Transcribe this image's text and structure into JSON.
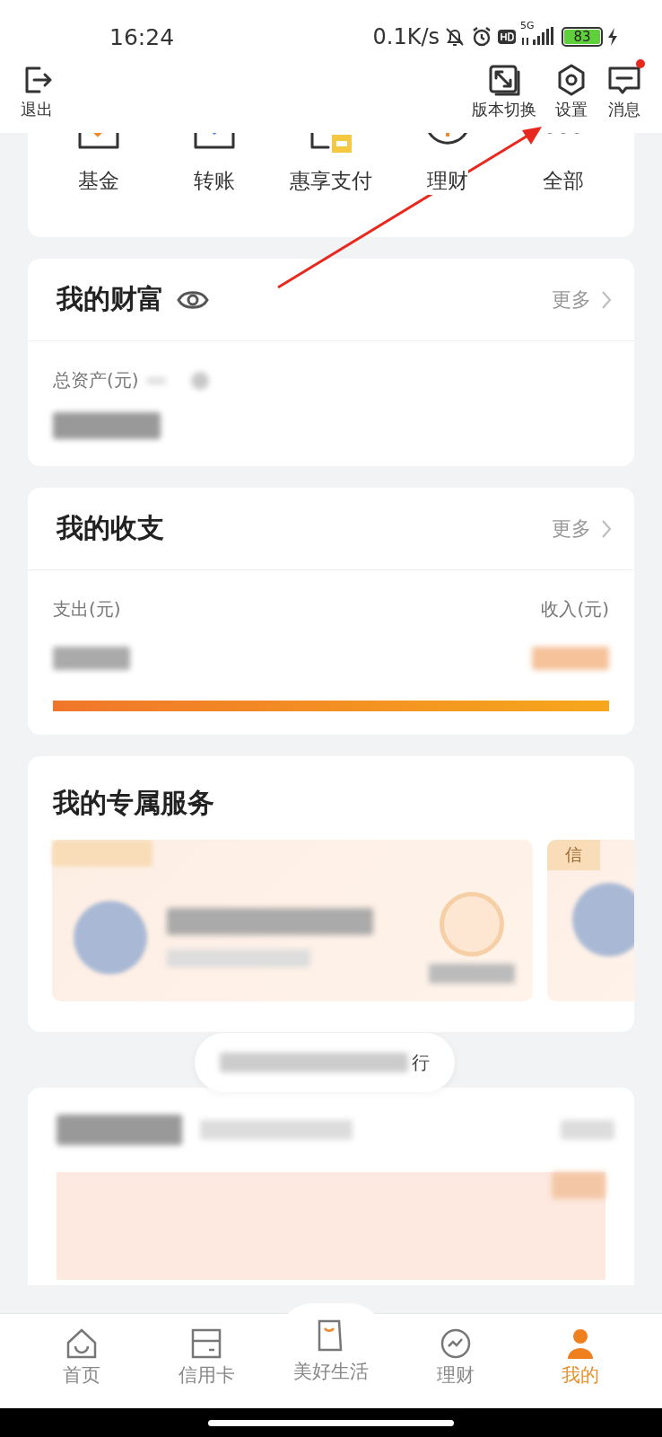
{
  "status_bar": {
    "time": "16:24",
    "speed": "0.1K/s",
    "network": "5G",
    "battery": "83"
  },
  "header": {
    "exit": "退出",
    "actions": [
      {
        "label": "版本切换",
        "kind": "switch",
        "unread": false
      },
      {
        "label": "设置",
        "kind": "settings",
        "unread": false
      },
      {
        "label": "消息",
        "kind": "message",
        "unread": true
      }
    ]
  },
  "shortcuts": [
    {
      "label": "基金",
      "kind": "fund"
    },
    {
      "label": "转账",
      "kind": "transfer"
    },
    {
      "label": "惠享支付",
      "kind": "pay"
    },
    {
      "label": "理财",
      "kind": "invest"
    },
    {
      "label": "全部",
      "kind": "all"
    }
  ],
  "wealth": {
    "title": "我的财富",
    "more": "更多",
    "total_label": "总资产(元)"
  },
  "cashflow": {
    "title": "我的收支",
    "more": "更多",
    "expense_label": "支出(元)",
    "income_label": "收入(元)"
  },
  "services": {
    "title": "我的专属服务",
    "side_tag": "信"
  },
  "toast": {
    "text": "行"
  },
  "tabs": [
    {
      "label": "首页",
      "kind": "home",
      "selected": false
    },
    {
      "label": "信用卡",
      "kind": "card",
      "selected": false
    },
    {
      "label": "美好生活",
      "kind": "life",
      "selected": false
    },
    {
      "label": "理财",
      "kind": "invest",
      "selected": false
    },
    {
      "label": "我的",
      "kind": "me",
      "selected": true
    }
  ]
}
